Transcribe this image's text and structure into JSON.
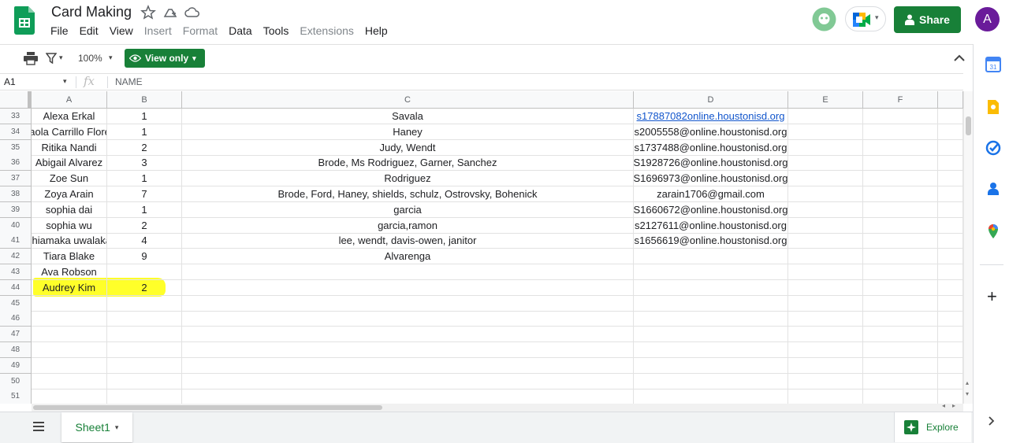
{
  "header": {
    "title": "Card Making",
    "menu": [
      {
        "label": "File",
        "disabled": false
      },
      {
        "label": "Edit",
        "disabled": false
      },
      {
        "label": "View",
        "disabled": false
      },
      {
        "label": "Insert",
        "disabled": true
      },
      {
        "label": "Format",
        "disabled": true
      },
      {
        "label": "Data",
        "disabled": false
      },
      {
        "label": "Tools",
        "disabled": false
      },
      {
        "label": "Extensions",
        "disabled": true
      },
      {
        "label": "Help",
        "disabled": false
      }
    ],
    "share_label": "Share",
    "avatar_letter": "A"
  },
  "toolbar": {
    "zoom": "100%",
    "view_only_label": "View only"
  },
  "formula_bar": {
    "cell_ref": "A1",
    "fx": "fx",
    "value": "NAME"
  },
  "grid": {
    "columns": [
      "A",
      "B",
      "C",
      "D",
      "E",
      "F"
    ],
    "rows": [
      {
        "num": "33",
        "a": "Alexa Erkal",
        "b": "1",
        "c": "Savala",
        "d": "s17887082online.houstonisd.org",
        "d_link": true
      },
      {
        "num": "34",
        "a": "Paola Carrillo Flores",
        "b": "1",
        "c": "Haney",
        "d": "s2005558@online.houstonisd.org"
      },
      {
        "num": "35",
        "a": "Ritika Nandi",
        "b": "2",
        "c": "Judy, Wendt",
        "d": "s1737488@online.houstonisd.org"
      },
      {
        "num": "36",
        "a": "Abigail Alvarez",
        "b": "3",
        "c": "Brode, Ms Rodriguez, Garner, Sanchez",
        "d": "S1928726@online.houstonisd.org"
      },
      {
        "num": "37",
        "a": "Zoe Sun",
        "b": "1",
        "c": "Rodriguez",
        "d": "S1696973@online.houstonisd.org"
      },
      {
        "num": "38",
        "a": "Zoya Arain",
        "b": "7",
        "c": "Brode, Ford, Haney, shields, schulz, Ostrovsky, Bohenick",
        "d": "zarain1706@gmail.com"
      },
      {
        "num": "39",
        "a": "sophia dai",
        "b": "1",
        "c": "garcia",
        "d": "S1660672@online.houstonisd.org"
      },
      {
        "num": "40",
        "a": "sophia wu",
        "b": "2",
        "c": "garcia,ramon",
        "d": "s2127611@online.houstonisd.org"
      },
      {
        "num": "41",
        "a": "chiamaka uwalaka",
        "b": "4",
        "c": "lee, wendt, davis-owen, janitor",
        "d": "s1656619@online.houstonisd.org"
      },
      {
        "num": "42",
        "a": "Tiara Blake",
        "b": "9",
        "c": "Alvarenga",
        "d": ""
      },
      {
        "num": "43",
        "a": "Ava Robson",
        "b": "",
        "c": "",
        "d": ""
      },
      {
        "num": "44",
        "a": "Audrey Kim",
        "b": "2",
        "c": "",
        "d": ""
      },
      {
        "num": "45",
        "a": "",
        "b": "",
        "c": "",
        "d": ""
      },
      {
        "num": "46",
        "a": "",
        "b": "",
        "c": "",
        "d": ""
      },
      {
        "num": "47",
        "a": "",
        "b": "",
        "c": "",
        "d": ""
      },
      {
        "num": "48",
        "a": "",
        "b": "",
        "c": "",
        "d": ""
      },
      {
        "num": "49",
        "a": "",
        "b": "",
        "c": "",
        "d": ""
      },
      {
        "num": "50",
        "a": "",
        "b": "",
        "c": "",
        "d": ""
      },
      {
        "num": "51",
        "a": "",
        "b": "",
        "c": "",
        "d": ""
      }
    ]
  },
  "bottom": {
    "sheet_tab": "Sheet1",
    "explore_label": "Explore"
  },
  "colors": {
    "brand_green": "#188038",
    "highlight": "#ffff29",
    "link": "#1155cc"
  }
}
